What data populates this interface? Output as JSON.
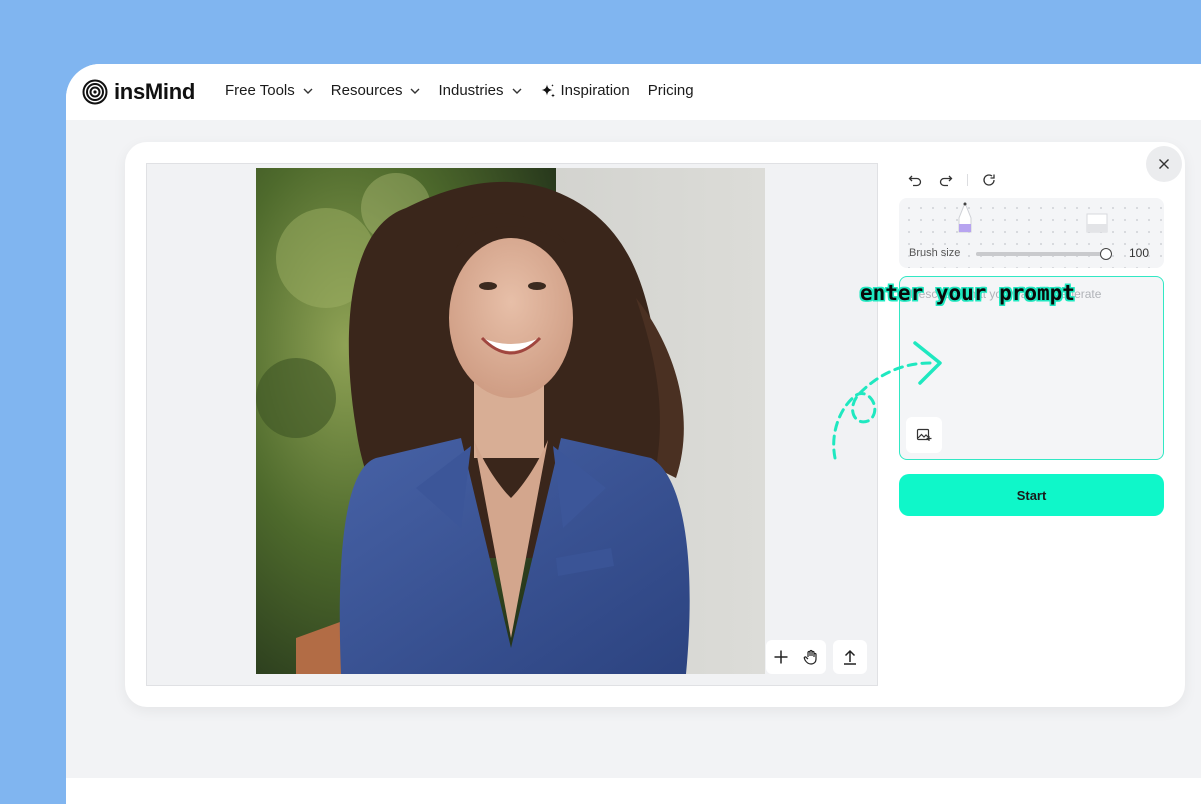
{
  "brand": {
    "name": "insMind"
  },
  "nav": {
    "items": [
      {
        "label": "Free Tools",
        "dropdown": true
      },
      {
        "label": "Resources",
        "dropdown": true
      },
      {
        "label": "Industries",
        "dropdown": true
      },
      {
        "label": "Inspiration",
        "icon": "sparkle-icon"
      },
      {
        "label": "Pricing"
      }
    ]
  },
  "editor": {
    "history": [
      "undo-icon",
      "redo-icon",
      "reset-icon"
    ],
    "brush": {
      "label": "Brush size",
      "value": 100,
      "min": 0,
      "max": 100,
      "display": "100"
    },
    "prompt": {
      "placeholder": "Describe what you want to generate",
      "value": ""
    },
    "start_label": "Start",
    "canvas_tools": [
      "add-icon",
      "hand-icon",
      "upload-icon"
    ]
  },
  "annotation": {
    "text": "enter your prompt"
  },
  "colors": {
    "background": "#80b5f0",
    "accent": "#0ff7c9",
    "prompt_border": "#31e8c4",
    "annotation": "#1fe8c0"
  }
}
